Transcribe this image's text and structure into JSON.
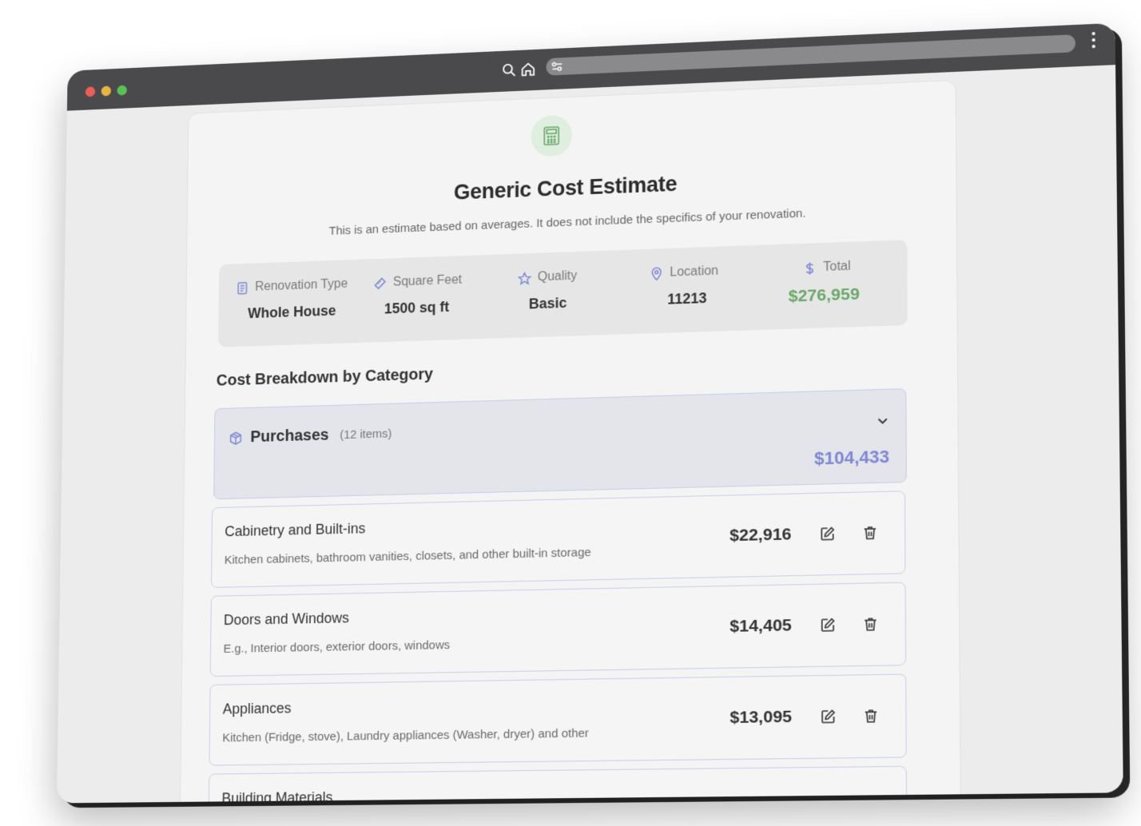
{
  "page": {
    "title": "Generic Cost Estimate",
    "subtitle": "This is an estimate based on averages. It does not include the specifics of your renovation."
  },
  "summary": {
    "renovation_type": {
      "label": "Renovation Type",
      "value": "Whole House",
      "icon": "document-icon"
    },
    "square_feet": {
      "label": "Square Feet",
      "value": "1500 sq ft",
      "icon": "ruler-icon"
    },
    "quality": {
      "label": "Quality",
      "value": "Basic",
      "icon": "star-icon"
    },
    "location": {
      "label": "Location",
      "value": "11213",
      "icon": "map-pin-icon"
    },
    "total": {
      "label": "Total",
      "value": "$276,959",
      "icon": "dollar-icon"
    }
  },
  "breakdown": {
    "title": "Cost Breakdown by Category",
    "category": {
      "name": "Purchases",
      "count": "(12 items)",
      "total": "$104,433",
      "icon": "package-icon"
    },
    "items": [
      {
        "name": "Cabinetry and Built-ins",
        "description": "Kitchen cabinets, bathroom vanities, closets, and other built-in storage",
        "amount": "$22,916"
      },
      {
        "name": "Doors and Windows",
        "description": "E.g., Interior doors, exterior doors, windows",
        "amount": "$14,405"
      },
      {
        "name": "Appliances",
        "description": "Kitchen (Fridge, stove), Laundry appliances (Washer, dryer) and other",
        "amount": "$13,095"
      },
      {
        "name": "Building Materials",
        "description": "",
        "amount": ""
      }
    ]
  },
  "colors": {
    "accent": "#7f86d4",
    "total_green": "#6aa868",
    "titlebar": "#4a4a4c"
  }
}
